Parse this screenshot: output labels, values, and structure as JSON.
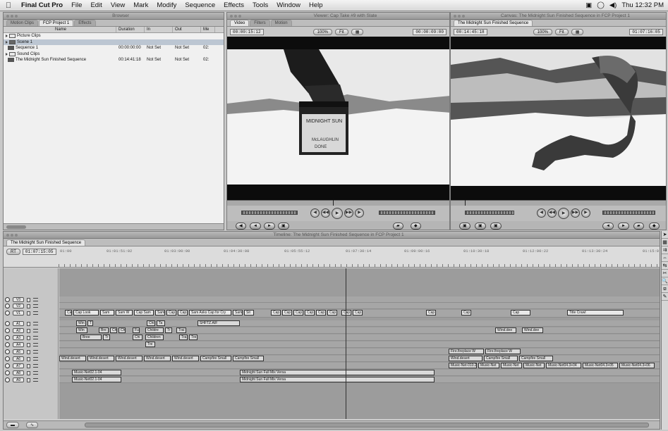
{
  "menubar": {
    "app": "Final Cut Pro",
    "items": [
      "File",
      "Edit",
      "View",
      "Mark",
      "Modify",
      "Sequence",
      "Effects",
      "Tools",
      "Window",
      "Help"
    ],
    "clock": "Thu 12:32 PM"
  },
  "browser": {
    "title": "Browser",
    "tabs": [
      "Motion Clips",
      "FCP Project 1",
      "Effects"
    ],
    "columns": [
      "Name",
      "Duration",
      "In",
      "Out",
      "Me"
    ],
    "rows": [
      {
        "name": "Picture Clips",
        "duration": "",
        "in": "",
        "out": "",
        "me": ""
      },
      {
        "name": "Scene 1",
        "duration": "",
        "in": "",
        "out": "",
        "me": ""
      },
      {
        "name": "Sequence 1",
        "duration": "00:00:00:00",
        "in": "Not Set",
        "out": "Not Set",
        "me": "02:"
      },
      {
        "name": "Sound Clips",
        "duration": "",
        "in": "",
        "out": "",
        "me": ""
      },
      {
        "name": "The Midnight Sun Finished Sequence",
        "duration": "00:14:41:18",
        "in": "Not Set",
        "out": "Not Set",
        "me": "02:"
      }
    ]
  },
  "viewer": {
    "title": "Viewer: Cap Take #9 with Slate",
    "tabs": [
      "Video",
      "Filters",
      "Motion"
    ],
    "timecode_left": "00:00:15:12",
    "zoom": "100%",
    "view": "Fit",
    "timecode_right": "00:00:09:00"
  },
  "canvas": {
    "title": "Canvas: The Midnight Sun Finished Sequence in FCP Project 1",
    "tabs": [
      "The Midnight Sun Finished Sequence"
    ],
    "timecode_left": "00:14:45:18",
    "zoom": "100%",
    "view": "Fit",
    "timecode_right": "01:07:16:05"
  },
  "timeline": {
    "title": "Timeline: The Midnight Sun Finished Sequence in FCP Project 1",
    "tab": "The Midnight Sun Finished Sequence",
    "zoom_label": "RT",
    "timecode": "01:07:15:05",
    "ruler": [
      "01:00",
      "01:01:51:02",
      "01:03:00:00",
      "01:04:30:08",
      "01:05:55:12",
      "01:07:30:14",
      "01:09:00:16",
      "01:10:30:18",
      "01:12:00:22",
      "01:13:30:24",
      "01:15:0"
    ],
    "tracks": [
      "V3",
      "V2",
      "V1",
      "A1",
      "A2",
      "A3",
      "A4",
      "A5",
      "A6",
      "A7",
      "A8",
      "A9"
    ],
    "clips": {
      "v1_left": [
        "Cap",
        "Cap Look",
        "Sam",
        "Sam W",
        "Cap Sam",
        "Sam",
        "Cap",
        "Cap",
        "Sam Asks Cap for Cry",
        "Sam",
        "Sit",
        "Cap",
        "Cap",
        "Cap",
        "Cap",
        "Cap",
        "Cap",
        "Cap",
        "Cap"
      ],
      "v1_right": [
        "Cap",
        "Cap",
        "Cap",
        "Title Crawl"
      ],
      "a1": [
        "Win",
        "T",
        "Chi",
        "Ta",
        "SHFTZ.AIF"
      ],
      "a2": [
        "Win",
        "Bre",
        "Chi",
        "Chi",
        "Ful",
        "Childre",
        "Tr",
        "Trai",
        "Wind.dee",
        "Wind.dee"
      ],
      "a3": [
        "Bree",
        "Tr",
        "Chi",
        "Children",
        "Tra",
        "Tre"
      ],
      "a4": [
        "Tre"
      ],
      "a5": [
        "Fire.fireplace W",
        "Fire.fireplace W"
      ],
      "a6": [
        "Wind.desert",
        "Wind.desert",
        "Wind.desert",
        "Wind.desert",
        "Wind.desert",
        "Campfire Small",
        "Campfire Small",
        "Wind.desert",
        "Campfire Small",
        "Campfire Small"
      ],
      "a7": [
        "Music-Net-010.2-06",
        "Music-Net",
        "Music-Net",
        "Music-Net",
        "Music-Net04.3+04",
        "Music-Net04.3+05",
        "Music-Net04.3+06"
      ],
      "a8": [
        "Music-Net02.1-04",
        "Midnight Sun Full Mix Versa"
      ],
      "a9": [
        "Music-Net02.1-04",
        "Midnight Sun Full Mix Versa"
      ]
    }
  },
  "colors": {
    "menubar": "#e6e6e6",
    "window_bg": "#cfcfcf",
    "video_bg": "#101010"
  }
}
